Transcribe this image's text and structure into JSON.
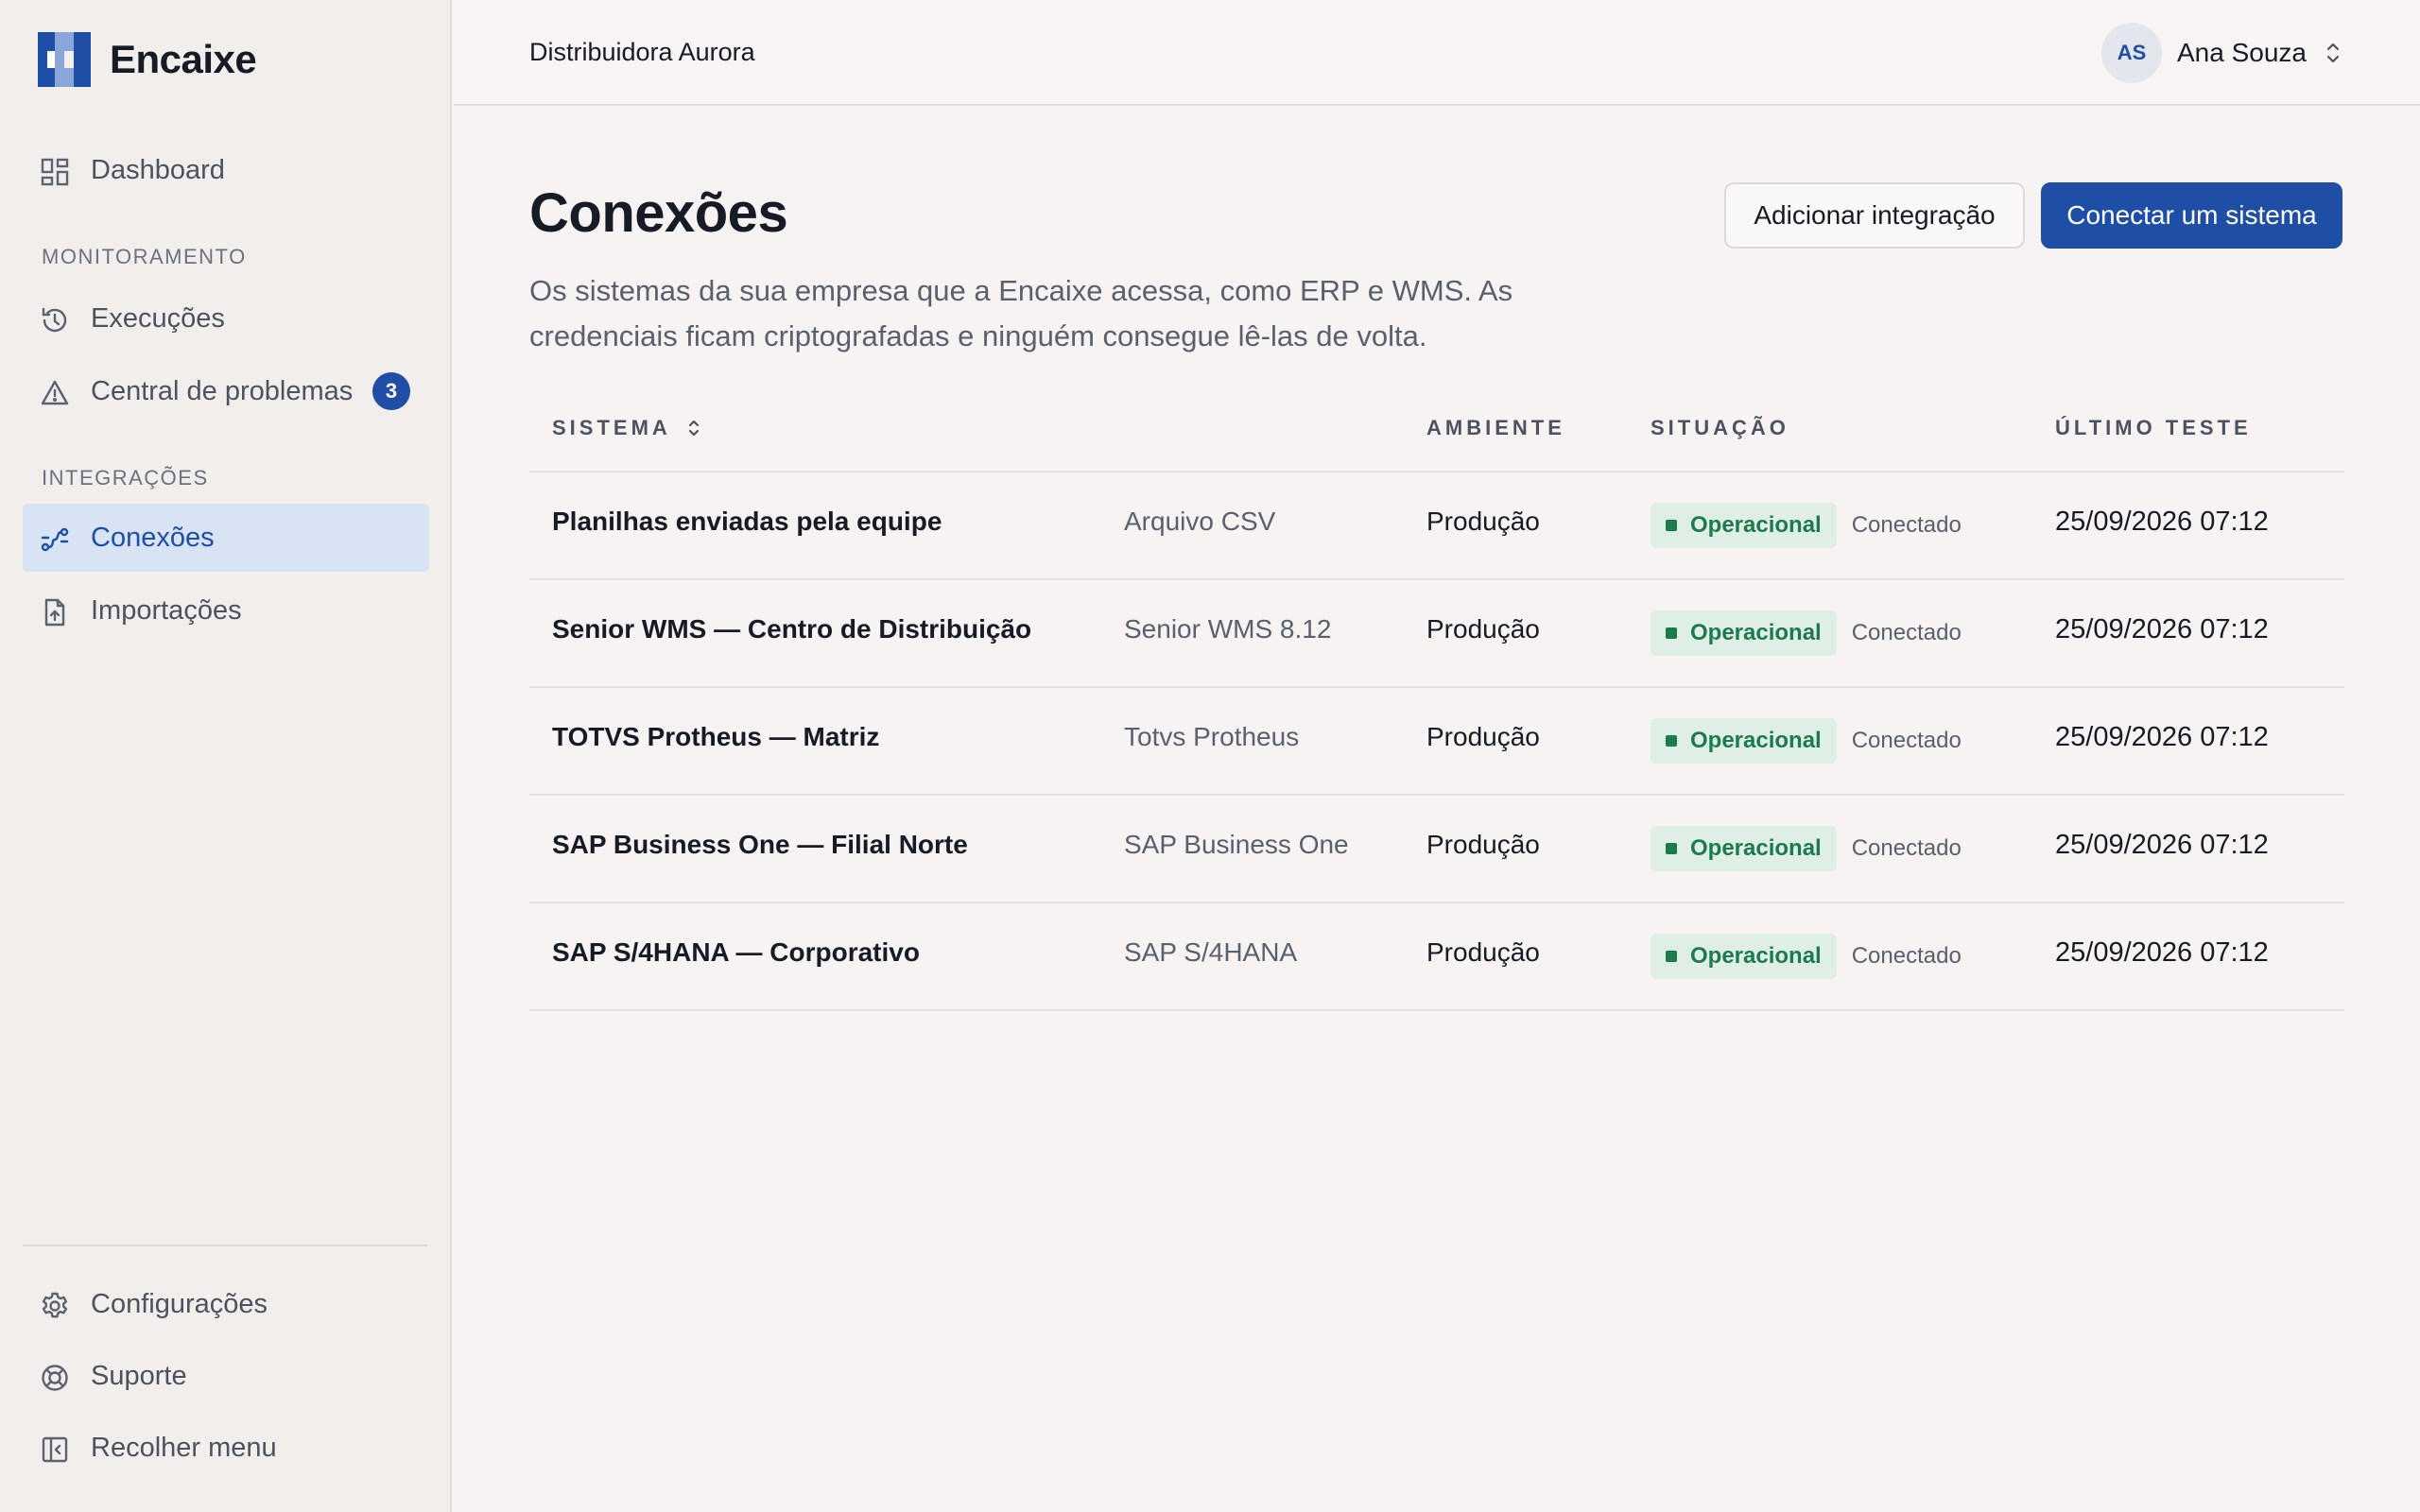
{
  "app": {
    "name": "Encaixe",
    "logo_icon": "encaixe-logo-icon"
  },
  "header": {
    "org_name": "Distribuidora Aurora",
    "user": {
      "initials": "AS",
      "name": "Ana Souza"
    }
  },
  "sidebar": {
    "dashboard": {
      "label": "Dashboard",
      "icon": "dashboard-icon"
    },
    "sections": {
      "monitoring": "MONITORAMENTO",
      "integrations": "INTEGRAÇÕES"
    },
    "executions": {
      "label": "Execuções",
      "icon": "history-icon"
    },
    "problems": {
      "label": "Central de problemas",
      "icon": "warning-icon",
      "badge": "3"
    },
    "connections": {
      "label": "Conexões",
      "icon": "connections-icon",
      "active": true
    },
    "imports": {
      "label": "Importações",
      "icon": "file-upload-icon"
    },
    "settings": {
      "label": "Configurações",
      "icon": "gear-icon"
    },
    "support": {
      "label": "Suporte",
      "icon": "lifebuoy-icon"
    },
    "collapse": {
      "label": "Recolher menu",
      "icon": "collapse-sidebar-icon"
    }
  },
  "main": {
    "title": "Conexões",
    "description": "Os sistemas da sua empresa que a Encaixe acessa, como ERP e WMS. As credenciais ficam criptografadas e ninguém consegue lê-las de volta.",
    "buttons": {
      "add_integration": "Adicionar integração",
      "connect_system": "Conectar um sistema"
    },
    "table": {
      "headers": {
        "system": "SISTEMA",
        "environment": "AMBIENTE",
        "status": "SITUAÇÃO",
        "last_test": "ÚLTIMO TESTE"
      },
      "rows": [
        {
          "name": "Planilhas enviadas pela equipe",
          "type": "Arquivo CSV",
          "environment": "Produção",
          "status": "Operacional",
          "status_note": "Conectado",
          "last_test": "25/09/2026 07:12"
        },
        {
          "name": "Senior WMS — Centro de Distribuição",
          "type": "Senior WMS 8.12",
          "environment": "Produção",
          "status": "Operacional",
          "status_note": "Conectado",
          "last_test": "25/09/2026 07:12"
        },
        {
          "name": "TOTVS Protheus — Matriz",
          "type": "Totvs Protheus",
          "environment": "Produção",
          "status": "Operacional",
          "status_note": "Conectado",
          "last_test": "25/09/2026 07:12"
        },
        {
          "name": "SAP Business One — Filial Norte",
          "type": "SAP Business One",
          "environment": "Produção",
          "status": "Operacional",
          "status_note": "Conectado",
          "last_test": "25/09/2026 07:12"
        },
        {
          "name": "SAP S/4HANA — Corporativo",
          "type": "SAP S/4HANA",
          "environment": "Produção",
          "status": "Operacional",
          "status_note": "Conectado",
          "last_test": "25/09/2026 07:12"
        }
      ]
    }
  },
  "colors": {
    "accent": "#1f4ea6",
    "status_ok": "#1d7a4e",
    "status_ok_bg": "#e0efe6",
    "active_nav_bg": "#d8e3f4"
  }
}
